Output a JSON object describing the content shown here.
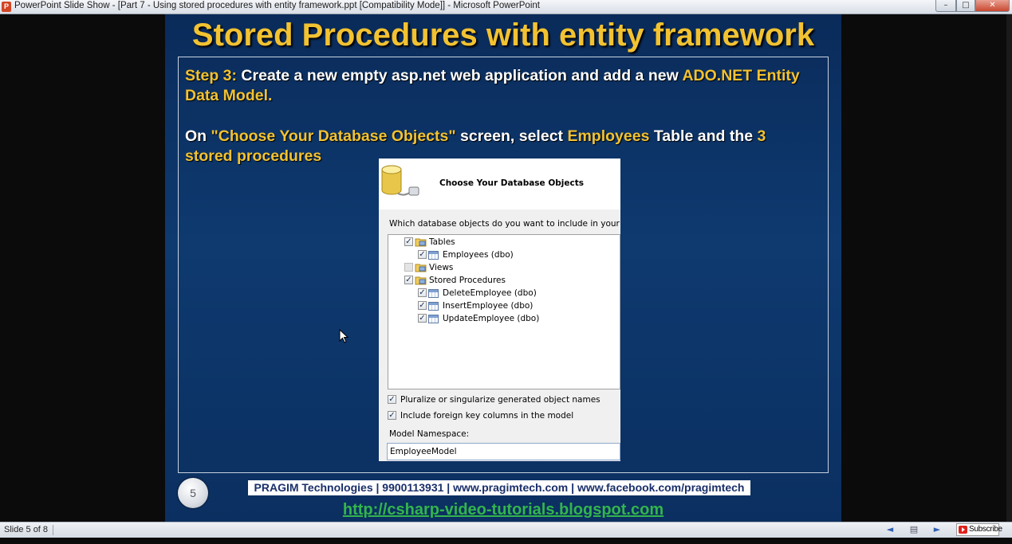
{
  "window": {
    "app_icon": "P",
    "title": "PowerPoint Slide Show - [Part 7 - Using stored procedures with entity framework.ppt [Compatibility Mode]] - Microsoft PowerPoint",
    "minimize_glyph": "–",
    "maximize_glyph": "□",
    "close_glyph": "✕"
  },
  "slide": {
    "title": "Stored Procedures with entity framework",
    "step_label": "Step 3:",
    "step_text_1": " Create a new empty asp.net web application and add a new ",
    "step_highlight": "ADO.NET Entity Data Model.",
    "on_text_1": "On ",
    "on_highlight_1": "\"Choose Your Database Objects\"",
    "on_text_2": " screen, select ",
    "on_highlight_2": "Employees",
    "on_text_3": " Table and the ",
    "on_highlight_3": "3 stored procedures",
    "number": "5",
    "contact_line": "PRAGIM Technologies | 9900113931 | www.pragimtech.com | www.facebook.com/pragimtech",
    "blog_url": "http://csharp-video-tutorials.blogspot.com"
  },
  "dialog": {
    "title": "Choose Your Database Objects",
    "question": "Which database objects do you want to include in your model?",
    "tree": {
      "tables_label": "Tables",
      "employees_label": "Employees (dbo)",
      "views_label": "Views",
      "sp_label": "Stored Procedures",
      "sp_items": [
        "DeleteEmployee (dbo)",
        "InsertEmployee (dbo)",
        "UpdateEmployee (dbo)"
      ]
    },
    "option_pluralize": "Pluralize or singularize generated object names",
    "option_foreign_keys": "Include foreign key columns in the model",
    "namespace_label": "Model Namespace:",
    "namespace_value": "EmployeeModel",
    "check_glyph": "✓"
  },
  "statusbar": {
    "slide_counter": "Slide 5 of 8",
    "prev_glyph": "◄",
    "menu_glyph": "▤",
    "next_glyph": "►",
    "subscribe_label": "Subscribe"
  },
  "colors": {
    "highlight": "#f2c231",
    "slide_background": "#0e3a70",
    "blog_link": "#33b54c"
  }
}
